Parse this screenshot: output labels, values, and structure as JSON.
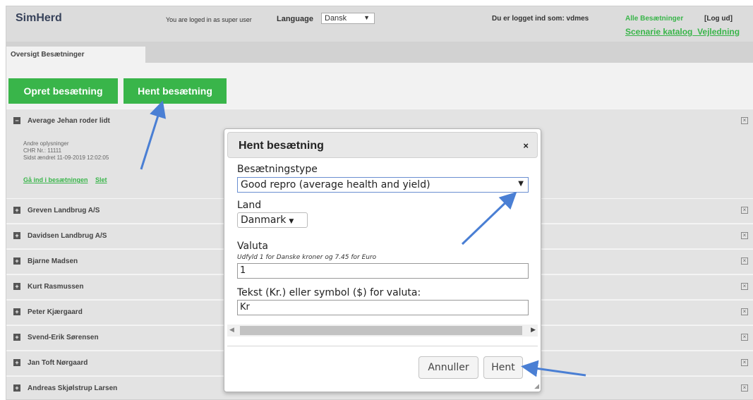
{
  "header": {
    "brand": "SimHerd",
    "logged_as": "You are loged in as super user",
    "language_label": "Language",
    "language_value": "Dansk",
    "user_info": "Du er logget ind som: vdmes",
    "all_herds": "Alle Besætninger",
    "logout": "[Log ud]",
    "link_catalog": "Scenarie katalog",
    "link_guide": "Vejledning"
  },
  "tabs": {
    "overview": "Oversigt Besætninger"
  },
  "actions": {
    "create": "Opret besætning",
    "fetch": "Hent besætning"
  },
  "herds": [
    "Average Jehan roder lidt",
    "Greven Landbrug A/S",
    "Davidsen Landbrug A/S",
    "Bjarne Madsen",
    "Kurt Rasmussen",
    "Peter Kjærgaard",
    "Svend-Erik Sørensen",
    "Jan Toft Nørgaard",
    "Andreas Skjølstrup Larsen"
  ],
  "detail": {
    "other_info": "Andre oplysninger",
    "chr": "CHR Nr.: 11111",
    "last_changed": "Sidst ændret 11-09-2019 12:02:05",
    "enter_link": "Gå ind i besætningen",
    "delete_link": "Slet"
  },
  "dialog": {
    "title": "Hent besætning",
    "close": "×",
    "type_label": "Besætningstype",
    "type_value": "Good repro (average health and yield)",
    "country_label": "Land",
    "country_value": "Danmark",
    "currency_label": "Valuta",
    "currency_hint": "Udfyld 1 for Danske kroner og 7.45 for Euro",
    "currency_value": "1",
    "symbol_label": "Tekst (Kr.) eller symbol ($) for valuta:",
    "symbol_value": "Kr",
    "cancel": "Annuller",
    "ok": "Hent"
  },
  "colors": {
    "accent_green": "#39b54a",
    "annotation_arrow": "#4a7fd4"
  }
}
